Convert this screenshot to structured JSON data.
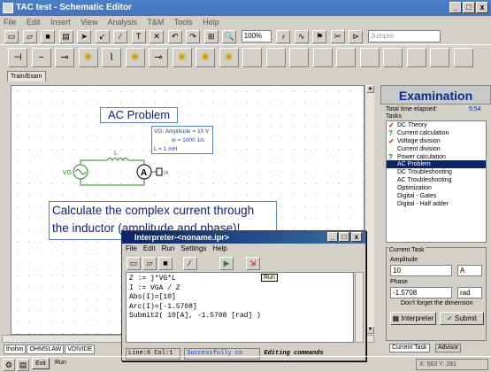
{
  "window": {
    "title": "TAC test - Schematic Editor",
    "min": "_",
    "max": "□",
    "close": "x"
  },
  "menu": [
    "File",
    "Edit",
    "Insert",
    "View",
    "Analysis",
    "T&M",
    "Tools",
    "Help"
  ],
  "toolbar": {
    "zoom": "100%",
    "jumper": "Jumper"
  },
  "tab_main": "Train/Exam",
  "canvas": {
    "problem_title": "AC Problem",
    "param1": "VG: Amplitude = 10 V",
    "param2": "w = 1000 1/s",
    "param3": "L = 1 mH",
    "src_label": "VG",
    "ind_label": "L",
    "meter_label": "IA",
    "calc_text": "Calculate the complex current through the inductor (amplitude and phase)!"
  },
  "bottom_tabs": [
    "thohm",
    "OHMSLAW",
    "VDIVIDE"
  ],
  "interpreter": {
    "title": "Interpreter-<noname.ipr>",
    "menu": [
      "File",
      "Edit",
      "Run",
      "Settings",
      "Help"
    ],
    "tooltip": "Run",
    "code": [
      "Z := j*VG*L",
      "I := VGA / Z",
      "Abs(I)=[10]",
      "Arc(I)=[-1.5708]",
      "Submit2( 10[A], -1.5708 [rad] )"
    ],
    "status_line": "Line:6 Col:1",
    "status_msg": "Successfully co",
    "status_mode": "Editing commands"
  },
  "panel": {
    "title": "Examination",
    "elapsed_label": "Total time elapsed:",
    "elapsed_value": "5:54",
    "tasks_label": "Tasks",
    "tasks": [
      {
        "name": "DC Theory",
        "mark": "check"
      },
      {
        "name": "Current calculation",
        "mark": "question"
      },
      {
        "name": "Voltage division",
        "mark": "check"
      },
      {
        "name": "Current division",
        "mark": ""
      },
      {
        "name": "Power calculation",
        "mark": "question"
      },
      {
        "name": "AC Problem",
        "mark": "",
        "selected": true
      },
      {
        "name": "DC Troubleshooting",
        "mark": ""
      },
      {
        "name": "AC Troubleshooting",
        "mark": ""
      },
      {
        "name": "Optimization",
        "mark": ""
      },
      {
        "name": "Digital - Gates",
        "mark": ""
      },
      {
        "name": "Digital - Half adder",
        "mark": ""
      }
    ],
    "current_task_label": "Current Task",
    "amplitude_label": "Amplitude",
    "amplitude_value": "10",
    "amplitude_unit": "A",
    "phase_label": "Phase",
    "phase_value": "-1.5708",
    "phase_unit": "rad",
    "hint": "Don't forget the dimension",
    "interpreter_btn": "Interpreter",
    "submit_btn": "Submit",
    "tab1": "Current Task",
    "tab2": "Advisor"
  },
  "status": {
    "exit": "Exit",
    "run": "Run",
    "coords": "X: 563 Y: 281"
  }
}
